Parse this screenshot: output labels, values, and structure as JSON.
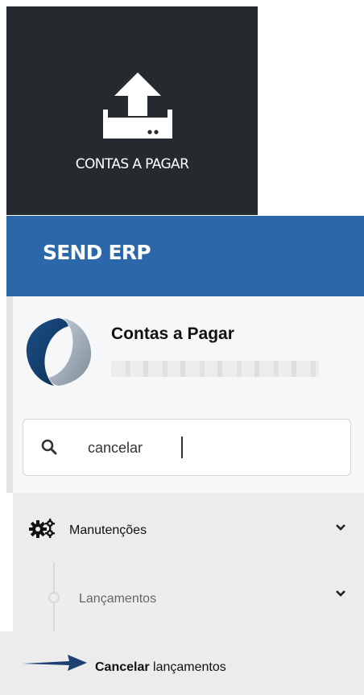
{
  "tile": {
    "label": "CONTAS A PAGAR",
    "icon": "upload-tray-icon"
  },
  "brand": {
    "title": "SEND ERP",
    "bar_color": "#2c67a9"
  },
  "module": {
    "name": "Contas a Pagar",
    "logo": "send-logo-icon"
  },
  "search": {
    "value": "cancelar",
    "icon": "search-icon"
  },
  "menu": {
    "group": {
      "label": "Manutenções",
      "icon": "gears-icon"
    },
    "subgroup": {
      "label": "Lançamentos"
    },
    "item": {
      "label_bold": "Cancelar",
      "label_rest": " lançamentos",
      "pointer_icon": "arrow-right-icon"
    }
  }
}
